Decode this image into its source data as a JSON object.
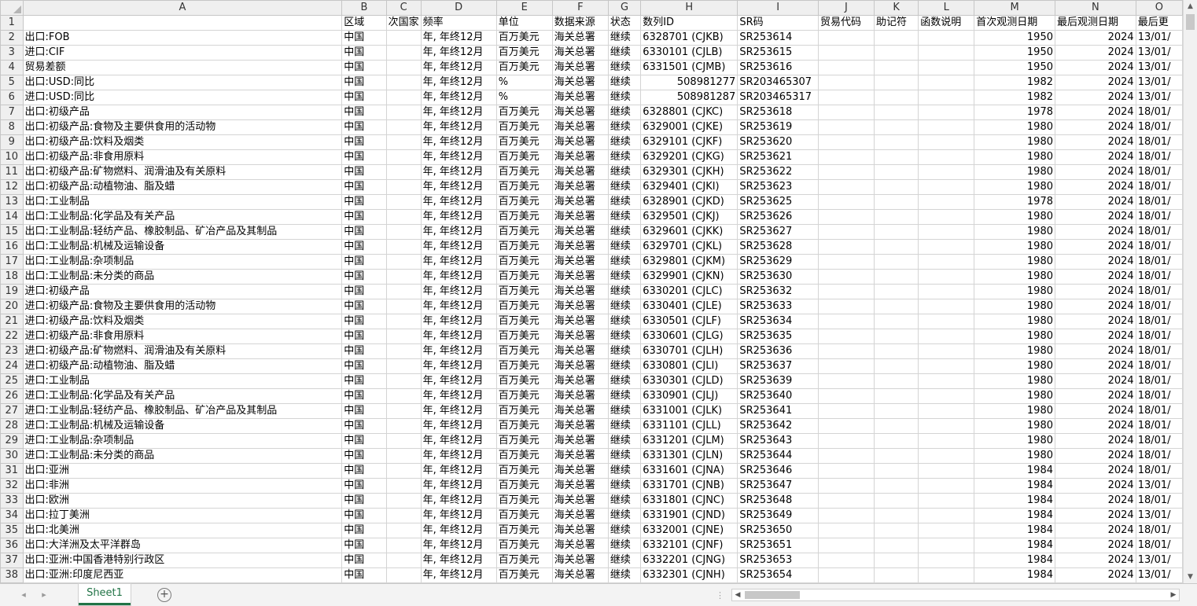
{
  "columns": [
    "A",
    "B",
    "C",
    "D",
    "E",
    "F",
    "G",
    "H",
    "I",
    "J",
    "K",
    "L",
    "M",
    "N",
    "O"
  ],
  "header_row": [
    "",
    "区域",
    "次国家",
    "频率",
    "单位",
    "数据来源",
    "状态",
    "数列ID",
    "SR码",
    "贸易代码",
    "助记符",
    "函数说明",
    "首次观测日期",
    "最后观测日期",
    "最后更"
  ],
  "rows": [
    [
      "出口:FOB",
      "中国",
      "",
      "年, 年终12月",
      "百万美元",
      "海关总署",
      "继续",
      "6328701 (CJKB)",
      "SR253614",
      "",
      "",
      "",
      "1950",
      "2024",
      "13/01/"
    ],
    [
      "进口:CIF",
      "中国",
      "",
      "年, 年终12月",
      "百万美元",
      "海关总署",
      "继续",
      "6330101 (CJLB)",
      "SR253615",
      "",
      "",
      "",
      "1950",
      "2024",
      "13/01/"
    ],
    [
      "贸易差额",
      "中国",
      "",
      "年, 年终12月",
      "百万美元",
      "海关总署",
      "继续",
      "6331501 (CJMB)",
      "SR253616",
      "",
      "",
      "",
      "1950",
      "2024",
      "13/01/"
    ],
    [
      "出口:USD:同比",
      "中国",
      "",
      "年, 年终12月",
      "%",
      "海关总署",
      "继续",
      "508981277",
      "SR203465307",
      "",
      "",
      "",
      "1982",
      "2024",
      "13/01/"
    ],
    [
      "进口:USD:同比",
      "中国",
      "",
      "年, 年终12月",
      "%",
      "海关总署",
      "继续",
      "508981287",
      "SR203465317",
      "",
      "",
      "",
      "1982",
      "2024",
      "13/01/"
    ],
    [
      "出口:初级产品",
      "中国",
      "",
      "年, 年终12月",
      "百万美元",
      "海关总署",
      "继续",
      "6328801 (CJKC)",
      "SR253618",
      "",
      "",
      "",
      "1978",
      "2024",
      "18/01/"
    ],
    [
      "出口:初级产品:食物及主要供食用的活动物",
      "中国",
      "",
      "年, 年终12月",
      "百万美元",
      "海关总署",
      "继续",
      "6329001 (CJKE)",
      "SR253619",
      "",
      "",
      "",
      "1980",
      "2024",
      "18/01/"
    ],
    [
      "出口:初级产品:饮料及烟类",
      "中国",
      "",
      "年, 年终12月",
      "百万美元",
      "海关总署",
      "继续",
      "6329101 (CJKF)",
      "SR253620",
      "",
      "",
      "",
      "1980",
      "2024",
      "18/01/"
    ],
    [
      "出口:初级产品:非食用原料",
      "中国",
      "",
      "年, 年终12月",
      "百万美元",
      "海关总署",
      "继续",
      "6329201 (CJKG)",
      "SR253621",
      "",
      "",
      "",
      "1980",
      "2024",
      "18/01/"
    ],
    [
      "出口:初级产品:矿物燃料、润滑油及有关原料",
      "中国",
      "",
      "年, 年终12月",
      "百万美元",
      "海关总署",
      "继续",
      "6329301 (CJKH)",
      "SR253622",
      "",
      "",
      "",
      "1980",
      "2024",
      "18/01/"
    ],
    [
      "出口:初级产品:动植物油、脂及蜡",
      "中国",
      "",
      "年, 年终12月",
      "百万美元",
      "海关总署",
      "继续",
      "6329401 (CJKI)",
      "SR253623",
      "",
      "",
      "",
      "1980",
      "2024",
      "18/01/"
    ],
    [
      "出口:工业制品",
      "中国",
      "",
      "年, 年终12月",
      "百万美元",
      "海关总署",
      "继续",
      "6328901 (CJKD)",
      "SR253625",
      "",
      "",
      "",
      "1978",
      "2024",
      "18/01/"
    ],
    [
      "出口:工业制品:化学品及有关产品",
      "中国",
      "",
      "年, 年终12月",
      "百万美元",
      "海关总署",
      "继续",
      "6329501 (CJKJ)",
      "SR253626",
      "",
      "",
      "",
      "1980",
      "2024",
      "18/01/"
    ],
    [
      "出口:工业制品:轻纺产品、橡胶制品、矿冶产品及其制品",
      "中国",
      "",
      "年, 年终12月",
      "百万美元",
      "海关总署",
      "继续",
      "6329601 (CJKK)",
      "SR253627",
      "",
      "",
      "",
      "1980",
      "2024",
      "18/01/"
    ],
    [
      "出口:工业制品:机械及运输设备",
      "中国",
      "",
      "年, 年终12月",
      "百万美元",
      "海关总署",
      "继续",
      "6329701 (CJKL)",
      "SR253628",
      "",
      "",
      "",
      "1980",
      "2024",
      "18/01/"
    ],
    [
      "出口:工业制品:杂项制品",
      "中国",
      "",
      "年, 年终12月",
      "百万美元",
      "海关总署",
      "继续",
      "6329801 (CJKM)",
      "SR253629",
      "",
      "",
      "",
      "1980",
      "2024",
      "18/01/"
    ],
    [
      "出口:工业制品:未分类的商品",
      "中国",
      "",
      "年, 年终12月",
      "百万美元",
      "海关总署",
      "继续",
      "6329901 (CJKN)",
      "SR253630",
      "",
      "",
      "",
      "1980",
      "2024",
      "18/01/"
    ],
    [
      "进口:初级产品",
      "中国",
      "",
      "年, 年终12月",
      "百万美元",
      "海关总署",
      "继续",
      "6330201 (CJLC)",
      "SR253632",
      "",
      "",
      "",
      "1980",
      "2024",
      "18/01/"
    ],
    [
      "进口:初级产品:食物及主要供食用的活动物",
      "中国",
      "",
      "年, 年终12月",
      "百万美元",
      "海关总署",
      "继续",
      "6330401 (CJLE)",
      "SR253633",
      "",
      "",
      "",
      "1980",
      "2024",
      "18/01/"
    ],
    [
      "进口:初级产品:饮料及烟类",
      "中国",
      "",
      "年, 年终12月",
      "百万美元",
      "海关总署",
      "继续",
      "6330501 (CJLF)",
      "SR253634",
      "",
      "",
      "",
      "1980",
      "2024",
      "18/01/"
    ],
    [
      "进口:初级产品:非食用原料",
      "中国",
      "",
      "年, 年终12月",
      "百万美元",
      "海关总署",
      "继续",
      "6330601 (CJLG)",
      "SR253635",
      "",
      "",
      "",
      "1980",
      "2024",
      "18/01/"
    ],
    [
      "进口:初级产品:矿物燃料、润滑油及有关原料",
      "中国",
      "",
      "年, 年终12月",
      "百万美元",
      "海关总署",
      "继续",
      "6330701 (CJLH)",
      "SR253636",
      "",
      "",
      "",
      "1980",
      "2024",
      "18/01/"
    ],
    [
      "进口:初级产品:动植物油、脂及蜡",
      "中国",
      "",
      "年, 年终12月",
      "百万美元",
      "海关总署",
      "继续",
      "6330801 (CJLI)",
      "SR253637",
      "",
      "",
      "",
      "1980",
      "2024",
      "18/01/"
    ],
    [
      "进口:工业制品",
      "中国",
      "",
      "年, 年终12月",
      "百万美元",
      "海关总署",
      "继续",
      "6330301 (CJLD)",
      "SR253639",
      "",
      "",
      "",
      "1980",
      "2024",
      "18/01/"
    ],
    [
      "进口:工业制品:化学品及有关产品",
      "中国",
      "",
      "年, 年终12月",
      "百万美元",
      "海关总署",
      "继续",
      "6330901 (CJLJ)",
      "SR253640",
      "",
      "",
      "",
      "1980",
      "2024",
      "18/01/"
    ],
    [
      "进口:工业制品:轻纺产品、橡胶制品、矿冶产品及其制品",
      "中国",
      "",
      "年, 年终12月",
      "百万美元",
      "海关总署",
      "继续",
      "6331001 (CJLK)",
      "SR253641",
      "",
      "",
      "",
      "1980",
      "2024",
      "18/01/"
    ],
    [
      "进口:工业制品:机械及运输设备",
      "中国",
      "",
      "年, 年终12月",
      "百万美元",
      "海关总署",
      "继续",
      "6331101 (CJLL)",
      "SR253642",
      "",
      "",
      "",
      "1980",
      "2024",
      "18/01/"
    ],
    [
      "进口:工业制品:杂项制品",
      "中国",
      "",
      "年, 年终12月",
      "百万美元",
      "海关总署",
      "继续",
      "6331201 (CJLM)",
      "SR253643",
      "",
      "",
      "",
      "1980",
      "2024",
      "18/01/"
    ],
    [
      "进口:工业制品:未分类的商品",
      "中国",
      "",
      "年, 年终12月",
      "百万美元",
      "海关总署",
      "继续",
      "6331301 (CJLN)",
      "SR253644",
      "",
      "",
      "",
      "1980",
      "2024",
      "18/01/"
    ],
    [
      "出口:亚洲",
      "中国",
      "",
      "年, 年终12月",
      "百万美元",
      "海关总署",
      "继续",
      "6331601 (CJNA)",
      "SR253646",
      "",
      "",
      "",
      "1984",
      "2024",
      "18/01/"
    ],
    [
      "出口:非洲",
      "中国",
      "",
      "年, 年终12月",
      "百万美元",
      "海关总署",
      "继续",
      "6331701 (CJNB)",
      "SR253647",
      "",
      "",
      "",
      "1984",
      "2024",
      "13/01/"
    ],
    [
      "出口:欧洲",
      "中国",
      "",
      "年, 年终12月",
      "百万美元",
      "海关总署",
      "继续",
      "6331801 (CJNC)",
      "SR253648",
      "",
      "",
      "",
      "1984",
      "2024",
      "18/01/"
    ],
    [
      "出口:拉丁美洲",
      "中国",
      "",
      "年, 年终12月",
      "百万美元",
      "海关总署",
      "继续",
      "6331901 (CJND)",
      "SR253649",
      "",
      "",
      "",
      "1984",
      "2024",
      "13/01/"
    ],
    [
      "出口:北美洲",
      "中国",
      "",
      "年, 年终12月",
      "百万美元",
      "海关总署",
      "继续",
      "6332001 (CJNE)",
      "SR253650",
      "",
      "",
      "",
      "1984",
      "2024",
      "18/01/"
    ],
    [
      "出口:大洋洲及太平洋群岛",
      "中国",
      "",
      "年, 年终12月",
      "百万美元",
      "海关总署",
      "继续",
      "6332101 (CJNF)",
      "SR253651",
      "",
      "",
      "",
      "1984",
      "2024",
      "18/01/"
    ],
    [
      "出口:亚洲:中国香港特别行政区",
      "中国",
      "",
      "年, 年终12月",
      "百万美元",
      "海关总署",
      "继续",
      "6332201 (CJNG)",
      "SR253653",
      "",
      "",
      "",
      "1984",
      "2024",
      "13/01/"
    ],
    [
      "出口:亚洲:印度尼西亚",
      "中国",
      "",
      "年, 年终12月",
      "百万美元",
      "海关总署",
      "继续",
      "6332301 (CJNH)",
      "SR253654",
      "",
      "",
      "",
      "1984",
      "2024",
      "13/01/"
    ]
  ],
  "sheet_tab": "Sheet1",
  "add_sheet_glyph": "+",
  "nav_prev": "◂",
  "nav_next": "▸",
  "dots": "⋮",
  "icons": {
    "add": "plus-circle-icon",
    "scroll_up": "triangle-up-icon",
    "scroll_down": "triangle-down-icon"
  },
  "accent_color": "#217346"
}
